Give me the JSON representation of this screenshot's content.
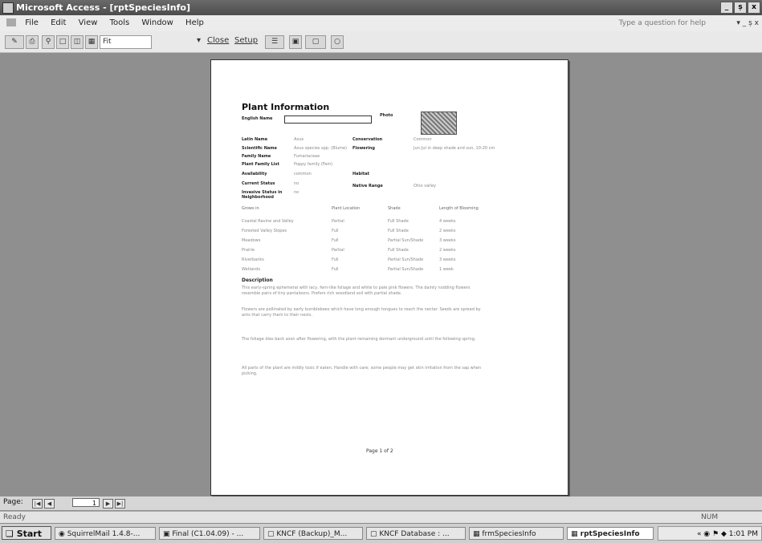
{
  "window": {
    "title": "Microsoft Access - [rptSpeciesInfo]",
    "controls": [
      "_",
      "ș",
      "x"
    ]
  },
  "menu": {
    "items": [
      "File",
      "Edit",
      "View",
      "Tools",
      "Window",
      "Help"
    ],
    "help_placeholder": "Type a question for help",
    "right_controls": "▾ _ ș x"
  },
  "toolbar": {
    "close_label": "Close",
    "setup_label": "Setup",
    "zoom_value": "Fit"
  },
  "report": {
    "title": "Plant Information",
    "fields": {
      "english_name": {
        "label": "English Name",
        "value": ""
      },
      "photo": {
        "label": "Photo"
      },
      "latin_name": {
        "label": "Latin Name",
        "value": "Axus"
      },
      "conservation": {
        "label": "Conservation",
        "value": "Common"
      },
      "scientific_name": {
        "label": "Scientific Name",
        "value": "Axus species spp. (Blume)"
      },
      "flowering": {
        "label": "Flowering",
        "value": "Jun-Jul in deep shade and sun, 10-20 cm"
      },
      "family_name": {
        "label": "Family Name",
        "value": "Fumariaceae"
      },
      "plant_family": {
        "label": "Plant Family List",
        "value": "Poppy family (Fam)"
      },
      "availability": {
        "label": "Availability",
        "value": "common"
      },
      "habitat": {
        "label": "Habitat",
        "value": ""
      },
      "current_status": {
        "label": "Current Status",
        "value": "no"
      },
      "native_range": {
        "label": "Native Range",
        "value": "Ohio valley"
      },
      "invasive": {
        "label": "Invasive Status in Neighborhood",
        "value": "no"
      }
    },
    "table": {
      "headers": [
        "Grows in",
        "Plant Location",
        "Shade",
        "Length of Blooming"
      ],
      "rows": [
        [
          "Coastal Ravine and Valley",
          "Partial",
          "Full Shade",
          "4 weeks"
        ],
        [
          "Forested Valley Slopes",
          "Full",
          "Full Shade",
          "2 weeks"
        ],
        [
          "Meadows",
          "Full",
          "Partial Sun/Shade",
          "3 weeks"
        ],
        [
          "Prairie",
          "Partial",
          "Full Shade",
          "2 weeks"
        ],
        [
          "Riverbanks",
          "Full",
          "Partial Sun/Shade",
          "3 weeks"
        ],
        [
          "Wetlands",
          "Full",
          "Partial Sun/Shade",
          "1 week"
        ]
      ]
    },
    "description_heading": "Description",
    "paragraphs": [
      "This early-spring ephemeral with lacy, fern-like foliage and white to pale pink flowers. The dainty nodding flowers resemble pairs of tiny pantaloons. Prefers rich woodland soil with partial shade.",
      "Flowers are pollinated by early bumblebees which have long enough tongues to reach the nectar. Seeds are spread by ants that carry them to their nests.",
      "The foliage dies back soon after flowering, with the plant remaining dormant underground until the following spring.",
      "All parts of the plant are mildly toxic if eaten. Handle with care; some people may get skin irritation from the sap when picking."
    ],
    "footer": "Page 1 of 2"
  },
  "nav": {
    "label": "Page:",
    "page_value": "1"
  },
  "status": {
    "left": "Ready",
    "right": "NUM"
  },
  "taskbar": {
    "start": "Start",
    "tasks": [
      "SquirrelMail 1.4.8-...",
      "Final (C1.04.09) - ...",
      "KNCF (Backup)_M...",
      "KNCF Database : ...",
      "frmSpeciesInfo",
      "rptSpeciesInfo"
    ],
    "clock": "1:01 PM"
  }
}
